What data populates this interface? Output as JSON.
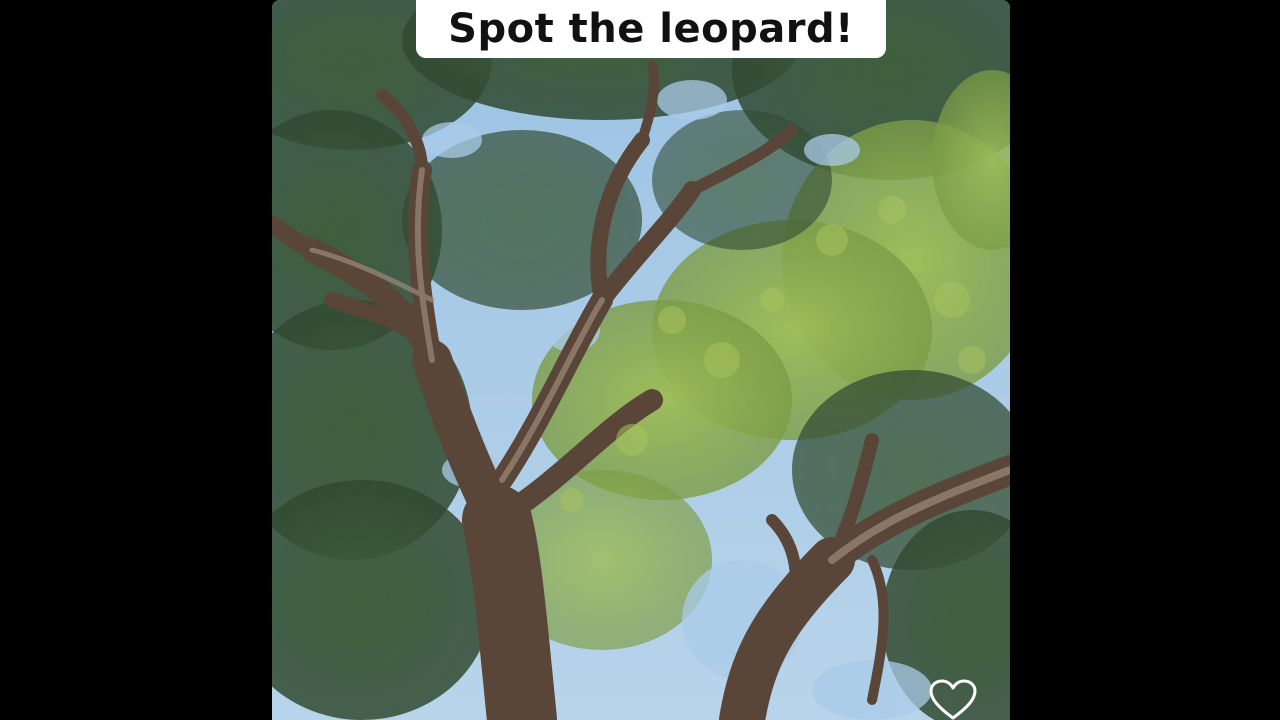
{
  "caption": {
    "text": "Spot the leopard!"
  },
  "photo": {
    "subject": "tree-canopy-photo"
  },
  "actions": {
    "like_icon": "heart-outline-icon"
  },
  "colors": {
    "background": "#000000",
    "caption_bg": "#ffffff",
    "caption_text": "#111111",
    "sky": "#8fb6d8",
    "foliage_dark": "#2f4a2a",
    "foliage_light": "#8fae46",
    "bark": "#5a4638",
    "icon_stroke": "#ffffff"
  }
}
